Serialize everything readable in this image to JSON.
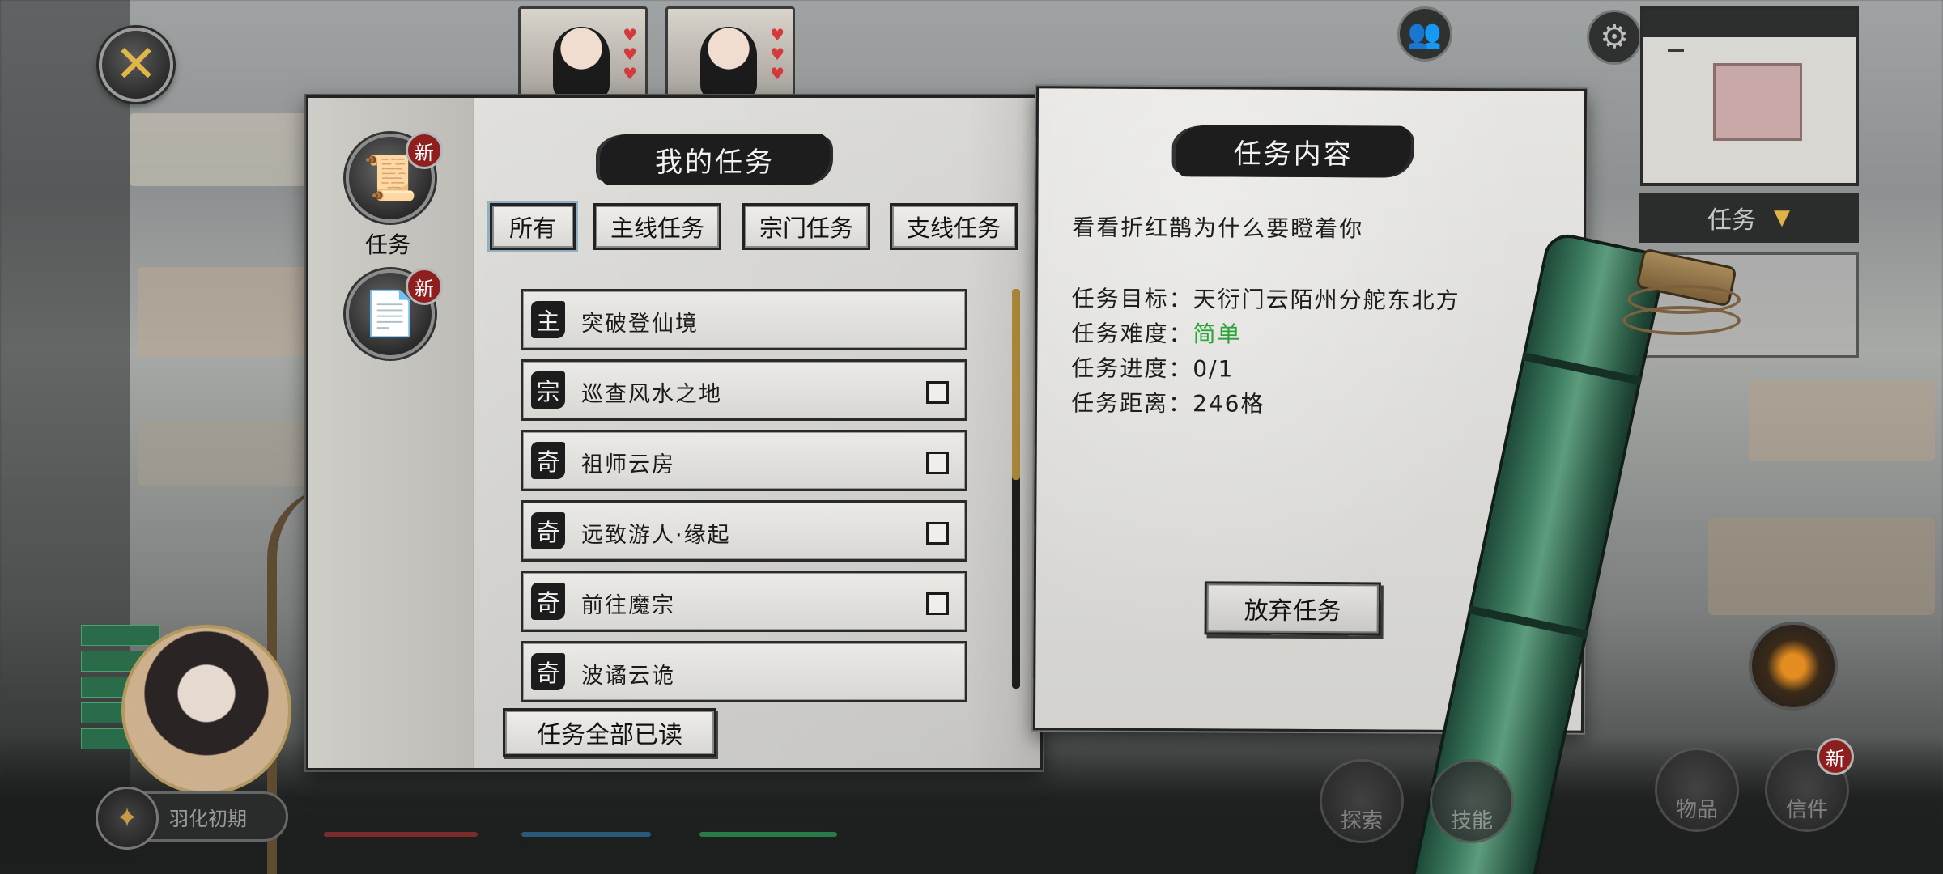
{
  "close_button": {
    "glyph": "✕"
  },
  "book": {
    "left_title": "我的任务",
    "right_title": "任务内容",
    "categories": [
      {
        "label": "任务",
        "badge": "新",
        "icon": "scroll-icon"
      },
      {
        "label": "",
        "badge": "新",
        "icon": "letter-icon"
      }
    ],
    "tabs": [
      {
        "label": "所有",
        "active": true
      },
      {
        "label": "主线任务",
        "active": false
      },
      {
        "label": "宗门任务",
        "active": false
      },
      {
        "label": "支线任务",
        "active": false
      }
    ],
    "quests": [
      {
        "type": "主",
        "name": "突破登仙境",
        "has_checkbox": false
      },
      {
        "type": "宗",
        "name": "巡查风水之地",
        "has_checkbox": true
      },
      {
        "type": "奇",
        "name": "祖师云房",
        "has_checkbox": true
      },
      {
        "type": "奇",
        "name": "远致游人·缘起",
        "has_checkbox": true
      },
      {
        "type": "奇",
        "name": "前往魔宗",
        "has_checkbox": true
      },
      {
        "type": "奇",
        "name": "波谲云诡",
        "has_checkbox": false
      }
    ],
    "scroll_position": 0.0,
    "read_all_label": "任务全部已读",
    "detail": {
      "description": "看看折红鹊为什么要瞪着你",
      "target_label": "任务目标：",
      "target_value": "天衍门云陌州分舵东北方",
      "difficulty_label": "任务难度：",
      "difficulty_value": "简单",
      "difficulty_color": "#2aa33a",
      "progress_label": "任务进度：",
      "progress_value": "0/1",
      "distance_label": "任务距离：",
      "distance_value": "246格"
    },
    "abandon_label": "放弃任务"
  },
  "hud": {
    "quest_tracker_label": "任务",
    "realm_label": "羽化初期",
    "bottom_buttons": [
      "探索",
      "技能",
      "物品",
      "信件"
    ],
    "letter_badge": "新"
  },
  "colors": {
    "paper": "#e2e1dd",
    "ink": "#1d1d1d",
    "accent_gold": "#a8873a",
    "badge_red": "#8e1f1f",
    "bamboo_green": "#3b7a5e"
  }
}
